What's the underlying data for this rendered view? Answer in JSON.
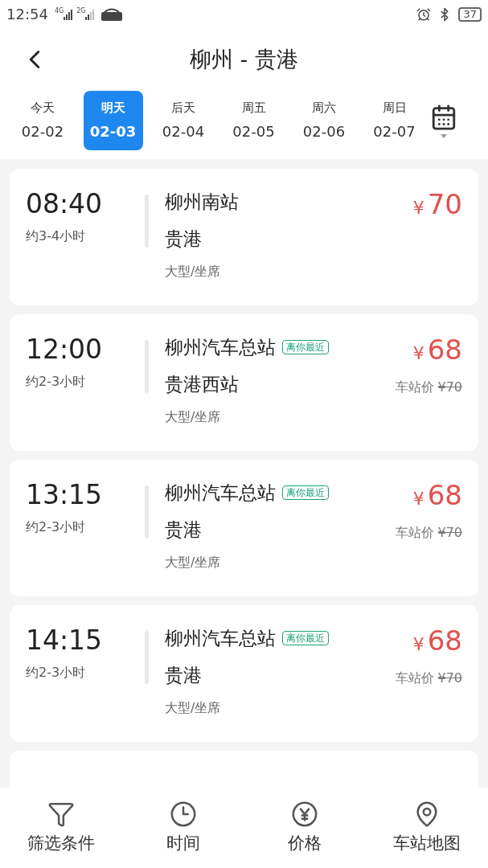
{
  "status_bar": {
    "time": "12:54",
    "signal_1": "4G",
    "signal_2": "2G",
    "battery": "37"
  },
  "header": {
    "title": "柳州 - 贵港"
  },
  "dates": [
    {
      "day": "今天",
      "date": "02-02",
      "selected": false
    },
    {
      "day": "明天",
      "date": "02-03",
      "selected": true
    },
    {
      "day": "后天",
      "date": "02-04",
      "selected": false
    },
    {
      "day": "周五",
      "date": "02-05",
      "selected": false
    },
    {
      "day": "周六",
      "date": "02-06",
      "selected": false
    },
    {
      "day": "周日",
      "date": "02-07",
      "selected": false
    }
  ],
  "trips": [
    {
      "time": "08:40",
      "duration": "约3-4小时",
      "from": "柳州南站",
      "to": "贵港",
      "bus_type": "大型/坐席",
      "price": "70"
    },
    {
      "time": "12:00",
      "duration": "约2-3小时",
      "from": "柳州汽车总站",
      "nearest": "离你最近",
      "to": "贵港西站",
      "bus_type": "大型/坐席",
      "price": "68",
      "station_price": {
        "label": "车站价",
        "value": "¥70"
      }
    },
    {
      "time": "13:15",
      "duration": "约2-3小时",
      "from": "柳州汽车总站",
      "nearest": "离你最近",
      "to": "贵港",
      "bus_type": "大型/坐席",
      "price": "68",
      "station_price": {
        "label": "车站价",
        "value": "¥70"
      }
    },
    {
      "time": "14:15",
      "duration": "约2-3小时",
      "from": "柳州汽车总站",
      "nearest": "离你最近",
      "to": "贵港",
      "bus_type": "大型/坐席",
      "price": "68",
      "station_price": {
        "label": "车站价",
        "value": "¥70"
      }
    }
  ],
  "currency": "¥",
  "bottom_nav": [
    {
      "kind": "filter",
      "label": "筛选条件"
    },
    {
      "kind": "time",
      "label": "时间"
    },
    {
      "kind": "price",
      "label": "价格"
    },
    {
      "kind": "map",
      "label": "车站地图"
    }
  ]
}
